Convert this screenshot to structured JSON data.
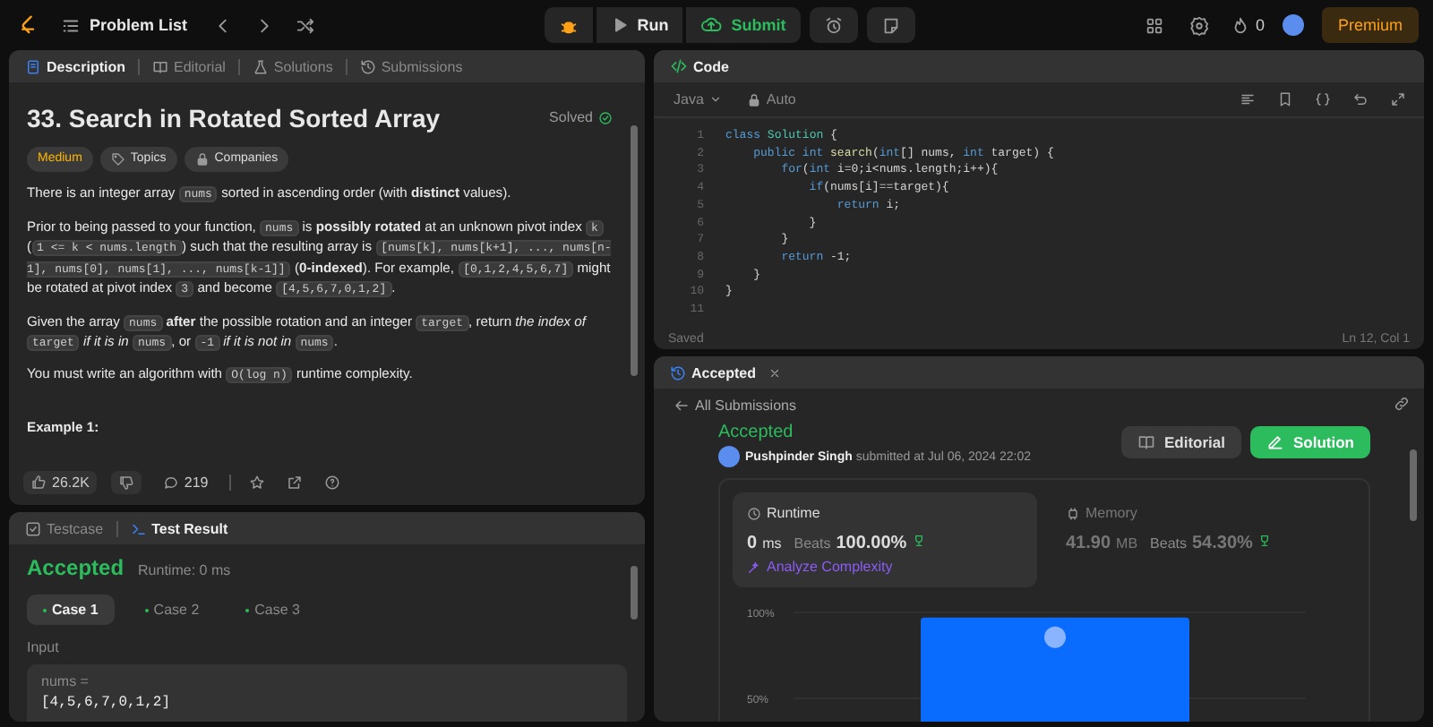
{
  "topbar": {
    "problem_list": "Problem List",
    "run": "Run",
    "submit": "Submit",
    "streak": "0",
    "premium": "Premium"
  },
  "description_panel": {
    "tabs": [
      {
        "label": "Description",
        "selected": true,
        "kind": "doc"
      },
      {
        "label": "Editorial",
        "selected": false,
        "kind": "book"
      },
      {
        "label": "Solutions",
        "selected": false,
        "kind": "flask"
      },
      {
        "label": "Submissions",
        "selected": false,
        "kind": "history"
      }
    ],
    "title": "33. Search in Rotated Sorted Array",
    "status": "Solved",
    "tags": [
      {
        "label": "Medium",
        "kind": "difficulty"
      },
      {
        "label": "Topics",
        "kind": "tag"
      },
      {
        "label": "Companies",
        "kind": "lock"
      }
    ],
    "paragraphs": [
      [
        {
          "kind": "text",
          "text": "There is an integer array "
        },
        {
          "kind": "code",
          "text": "nums"
        },
        {
          "kind": "text",
          "text": " sorted in ascending order (with **distinct** values)."
        }
      ],
      [
        {
          "kind": "text",
          "text": "Prior to being passed to your function, "
        },
        {
          "kind": "code",
          "text": "nums"
        },
        {
          "kind": "text",
          "text": " is **possibly rotated** at an unknown pivot index "
        },
        {
          "kind": "code",
          "text": "k"
        },
        {
          "kind": "text",
          "text": " ("
        },
        {
          "kind": "code",
          "text": "1 <= k < nums.length"
        },
        {
          "kind": "text",
          "text": ") such that the resulting array is "
        },
        {
          "kind": "code",
          "text": "[nums[k], nums[k+1], ..., nums[n-1], nums[0], nums[1], ..., nums[k-1]]"
        },
        {
          "kind": "text",
          "text": " (**0-indexed**). For example, "
        },
        {
          "kind": "code",
          "text": "[0,1,2,4,5,6,7]"
        },
        {
          "kind": "text",
          "text": " might be rotated at pivot index "
        },
        {
          "kind": "code",
          "text": "3"
        },
        {
          "kind": "text",
          "text": " and become "
        },
        {
          "kind": "code",
          "text": "[4,5,6,7,0,1,2]"
        },
        {
          "kind": "text",
          "text": "."
        }
      ],
      [
        {
          "kind": "text",
          "text": "Given the array "
        },
        {
          "kind": "code",
          "text": "nums"
        },
        {
          "kind": "text",
          "text": " **after** the possible rotation and an integer "
        },
        {
          "kind": "code",
          "text": "target"
        },
        {
          "kind": "text",
          "text": ", return *the index of* "
        },
        {
          "kind": "code",
          "text": "target"
        },
        {
          "kind": "text",
          "text": " *if it is in* "
        },
        {
          "kind": "code",
          "text": "nums"
        },
        {
          "kind": "text",
          "text": ", or "
        },
        {
          "kind": "code",
          "text": "-1"
        },
        {
          "kind": "text",
          "text": " *if it is not in* "
        },
        {
          "kind": "code",
          "text": "nums"
        },
        {
          "kind": "text",
          "text": "."
        }
      ],
      [
        {
          "kind": "text",
          "text": "You must write an algorithm with "
        },
        {
          "kind": "code",
          "text": "O(log n)"
        },
        {
          "kind": "text",
          "text": " runtime complexity."
        }
      ]
    ],
    "example_heading": "Example 1:",
    "likes": "26.2K",
    "comments": "219"
  },
  "test_panel": {
    "tabs": [
      {
        "label": "Testcase",
        "selected": false,
        "kind": "check"
      },
      {
        "label": "Test Result",
        "selected": true,
        "kind": "terminal"
      }
    ],
    "verdict": "Accepted",
    "runtime": "Runtime: 0 ms",
    "cases": [
      {
        "label": "Case 1",
        "selected": true
      },
      {
        "label": "Case 2",
        "selected": false
      },
      {
        "label": "Case 3",
        "selected": false
      }
    ],
    "input_label": "Input",
    "input_name": "nums =",
    "input_value": "[4,5,6,7,0,1,2]"
  },
  "code_panel": {
    "title": "Code",
    "language": "Java",
    "mode": "Auto",
    "lines": [
      {
        "number": "1",
        "tokens": [
          {
            "kind": "kw",
            "text": "class"
          },
          {
            "kind": "cls",
            "text": " Solution"
          },
          {
            "kind": "plain",
            "text": " {"
          }
        ]
      },
      {
        "number": "2",
        "tokens": [
          {
            "kind": "kw",
            "text": "    public"
          },
          {
            "kind": "kw",
            "text": " int"
          },
          {
            "kind": "fn",
            "text": " search"
          },
          {
            "kind": "plain",
            "text": "("
          },
          {
            "kind": "kw",
            "text": "int"
          },
          {
            "kind": "plain",
            "text": "[] nums, "
          },
          {
            "kind": "kw",
            "text": "int"
          },
          {
            "kind": "plain",
            "text": " target) {"
          }
        ]
      },
      {
        "number": "3",
        "tokens": [
          {
            "kind": "kw",
            "text": "        for"
          },
          {
            "kind": "plain",
            "text": "("
          },
          {
            "kind": "kw",
            "text": "int"
          },
          {
            "kind": "plain",
            "text": " i=0;i<nums.length;i++){"
          }
        ]
      },
      {
        "number": "4",
        "tokens": [
          {
            "kind": "kw",
            "text": "            if"
          },
          {
            "kind": "plain",
            "text": "(nums[i]==target){"
          }
        ]
      },
      {
        "number": "5",
        "tokens": [
          {
            "kind": "kw",
            "text": "                return"
          },
          {
            "kind": "plain",
            "text": " i;"
          }
        ]
      },
      {
        "number": "6",
        "tokens": [
          {
            "kind": "plain",
            "text": "            }"
          }
        ]
      },
      {
        "number": "7",
        "tokens": [
          {
            "kind": "plain",
            "text": "        }"
          }
        ]
      },
      {
        "number": "8",
        "tokens": [
          {
            "kind": "kw",
            "text": "        return"
          },
          {
            "kind": "plain",
            "text": " -1;"
          }
        ]
      },
      {
        "number": "9",
        "tokens": [
          {
            "kind": "plain",
            "text": "    }"
          }
        ]
      },
      {
        "number": "10",
        "tokens": [
          {
            "kind": "plain",
            "text": "}"
          }
        ]
      },
      {
        "number": "11"
      }
    ],
    "saved": "Saved",
    "cursor": "Ln 12, Col 1"
  },
  "result_panel": {
    "tab": "Accepted",
    "back": "All Submissions",
    "verdict": "Accepted",
    "author": "Pushpinder Singh",
    "submitted": "submitted at Jul 06, 2024 22:02",
    "editorial": "Editorial",
    "solution": "Solution",
    "stats": [
      {
        "kind": "runtime",
        "label": "Runtime",
        "value": "0",
        "unit": "ms",
        "beats_label": "Beats",
        "beats": "100.00%",
        "selected": true,
        "link": "Analyze Complexity"
      },
      {
        "kind": "memory",
        "label": "Memory",
        "value": "41.90",
        "unit": "MB",
        "beats_label": "Beats",
        "beats": "54.30%",
        "selected": false
      }
    ],
    "chart_data": {
      "type": "bar",
      "values": [
        97
      ],
      "ylim": [
        0,
        100
      ],
      "yticks": [
        {
          "value": 100,
          "label": "100%"
        },
        {
          "value": 50,
          "label": "50%"
        }
      ]
    }
  }
}
